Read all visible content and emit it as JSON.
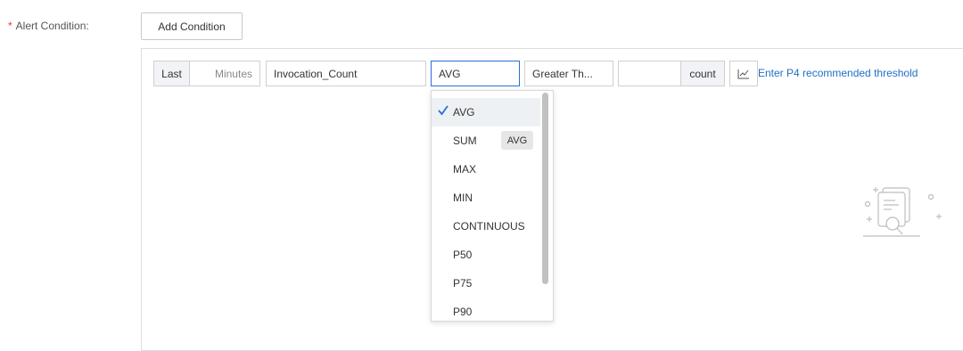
{
  "form": {
    "required_marker": "*",
    "label": "Alert Condition:",
    "add_button": "Add Condition"
  },
  "condition": {
    "last_addon": "Last",
    "minutes_placeholder": "Minutes",
    "metric_value": "Invocation_Count",
    "aggregation_value": "AVG",
    "operator_value": "Greater Th...",
    "threshold_value": "",
    "unit_addon": "count",
    "threshold_link": "Enter P4 recommended threshold"
  },
  "dropdown": {
    "options": [
      "AVG",
      "SUM",
      "MAX",
      "MIN",
      "CONTINUOUS",
      "P50",
      "P75",
      "P90"
    ],
    "selected": "AVG",
    "tooltip": "AVG"
  },
  "colors": {
    "accent": "#2a6fdb",
    "link": "#1f6fc5",
    "required": "#e0353b"
  }
}
